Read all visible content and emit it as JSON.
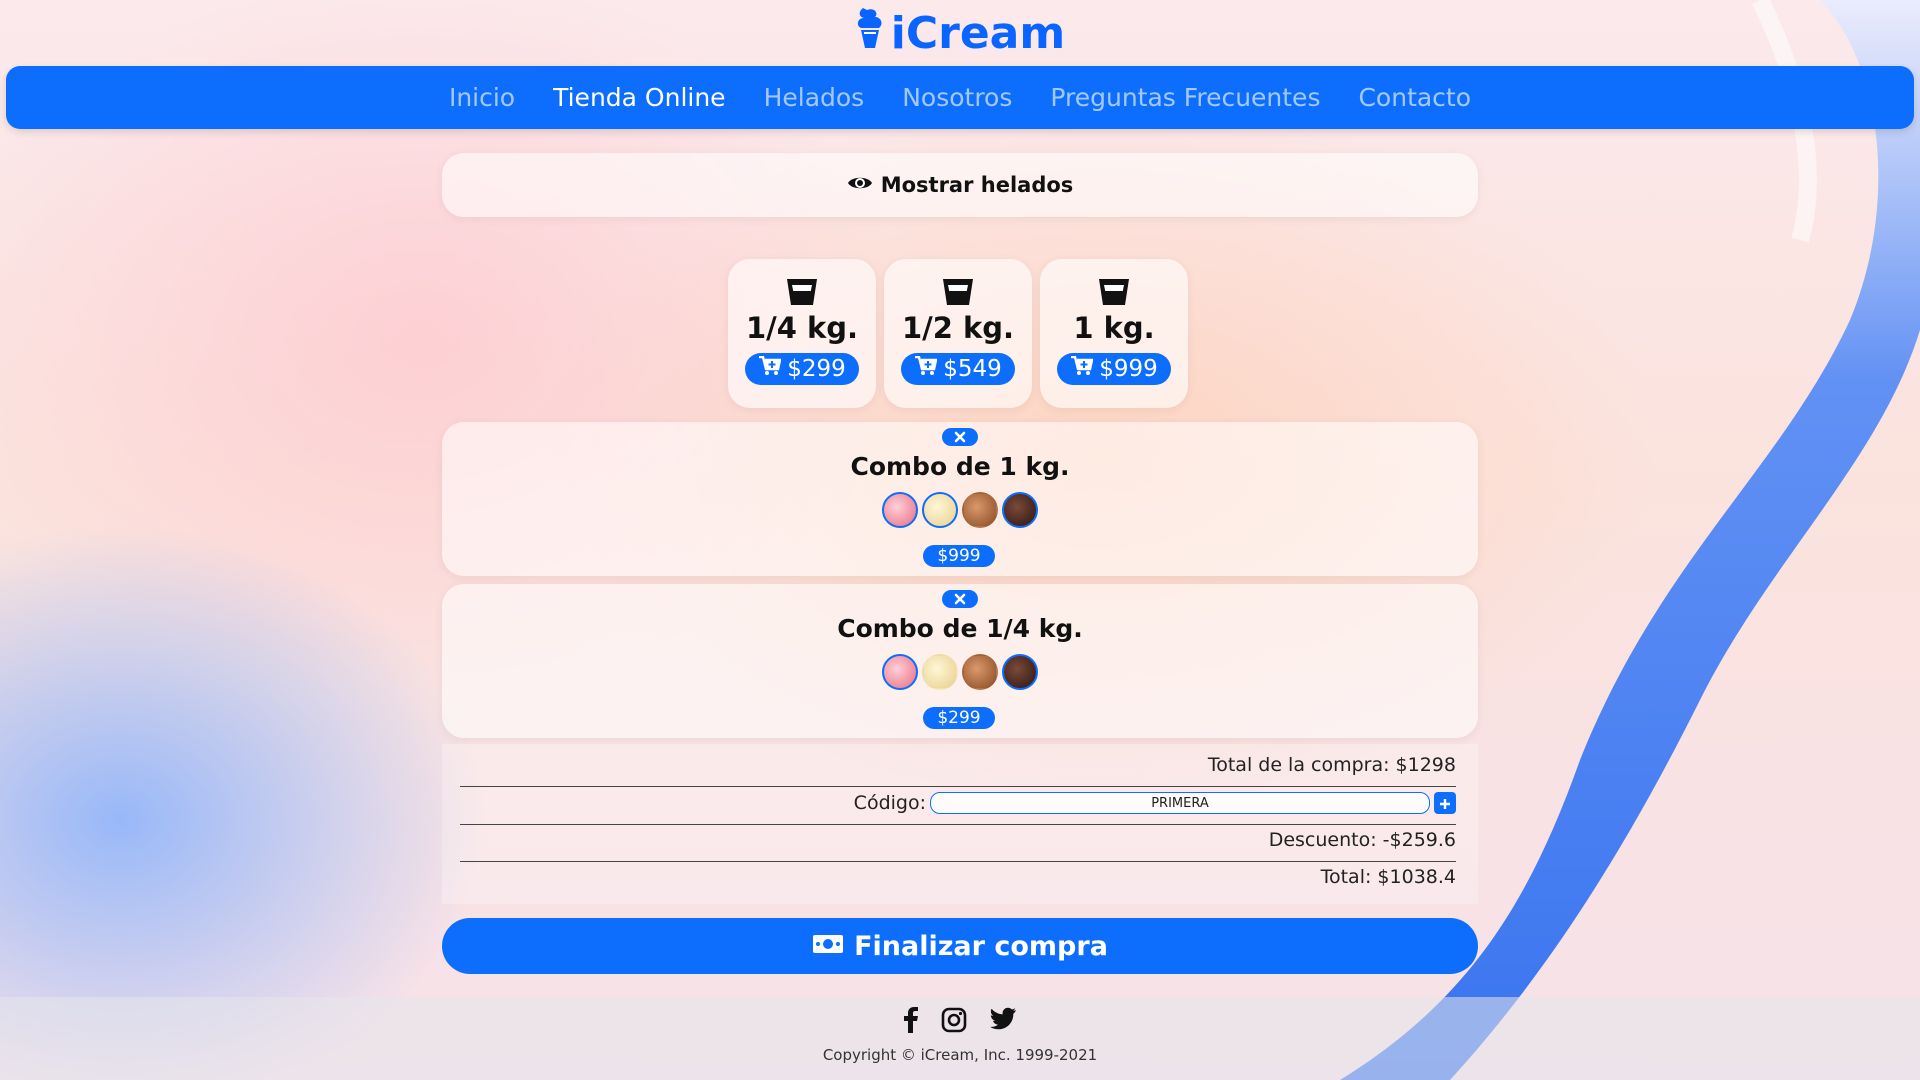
{
  "brand": {
    "name": "iCream",
    "logo_icon": "ice-cream-icon",
    "color": "#0a64ff"
  },
  "nav": {
    "items": [
      {
        "label": "Inicio",
        "active": false
      },
      {
        "label": "Tienda Online",
        "active": true
      },
      {
        "label": "Helados",
        "active": false
      },
      {
        "label": "Nosotros",
        "active": false
      },
      {
        "label": "Preguntas Frecuentes",
        "active": false
      },
      {
        "label": "Contacto",
        "active": false
      }
    ]
  },
  "show_flavors": {
    "label": "Mostrar helados",
    "icon": "eye-icon"
  },
  "sizes": [
    {
      "label": "1/4 kg.",
      "price": "$299",
      "icon": "cup-icon"
    },
    {
      "label": "1/2 kg.",
      "price": "$549",
      "icon": "cup-icon"
    },
    {
      "label": "1 kg.",
      "price": "$999",
      "icon": "cup-icon"
    }
  ],
  "cart": {
    "combos": [
      {
        "title": "Combo de 1 kg.",
        "price": "$999",
        "flavors": [
          "strawberry",
          "vanilla",
          "dulce-de-leche",
          "chocolate"
        ]
      },
      {
        "title": "Combo de 1/4 kg.",
        "price": "$299",
        "flavors": [
          "strawberry",
          "vanilla",
          "dulce-de-leche",
          "chocolate"
        ]
      }
    ]
  },
  "summary": {
    "subtotal": "Total de la compra: $1298",
    "code_label": "Código:",
    "code_value": "PRIMERA",
    "discount": "Descuento: -$259.6",
    "total": "Total: $1038.4"
  },
  "checkout": {
    "label": "Finalizar compra",
    "icon": "money-bill-icon"
  },
  "footer": {
    "social": [
      "facebook-icon",
      "instagram-icon",
      "twitter-icon"
    ],
    "copyright": "Copyright © iCream, Inc. 1999-2021"
  },
  "colors": {
    "primary": "#0d6efd"
  }
}
